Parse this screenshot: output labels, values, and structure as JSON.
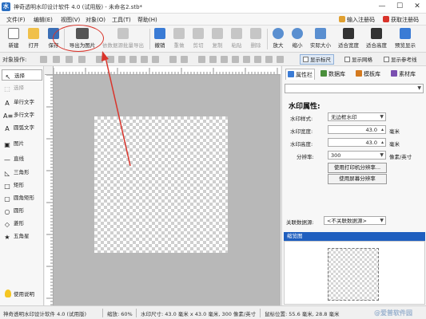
{
  "titlebar": {
    "title": "神奇透明水印设计软件 4.0 (试用版) - 未命名2.stb*",
    "app_icon_letter": "水",
    "min_glyph": "—",
    "max_glyph": "☐",
    "close_glyph": "✕"
  },
  "menubar": {
    "items": [
      "文件(F)",
      "编辑(E)",
      "视图(V)",
      "对象(O)",
      "工具(T)",
      "帮助(H)"
    ],
    "register_label": "输入注册码",
    "get_code_label": "获取注册码"
  },
  "toolbar": {
    "buttons": [
      {
        "label": "新建",
        "enabled": true
      },
      {
        "label": "打开",
        "enabled": true
      },
      {
        "label": "保存",
        "enabled": true
      },
      {
        "label": "导出为图片",
        "enabled": true
      },
      {
        "label": "依数据源批量导出",
        "enabled": false
      },
      {
        "label": "撤销",
        "enabled": true
      },
      {
        "label": "重做",
        "enabled": false
      },
      {
        "label": "剪切",
        "enabled": false
      },
      {
        "label": "复制",
        "enabled": false
      },
      {
        "label": "粘贴",
        "enabled": false
      },
      {
        "label": "删除",
        "enabled": false
      },
      {
        "label": "放大",
        "enabled": true
      },
      {
        "label": "缩小",
        "enabled": true
      },
      {
        "label": "实际大小",
        "enabled": true
      },
      {
        "label": "适合宽度",
        "enabled": true
      },
      {
        "label": "适合高度",
        "enabled": true
      },
      {
        "label": "预览显示",
        "enabled": true
      }
    ]
  },
  "objbar": {
    "label": "对象操作:",
    "toggles": [
      {
        "label": "显示标尺",
        "active": true
      },
      {
        "label": "显示网格",
        "active": false
      },
      {
        "label": "显示参考线",
        "active": false
      }
    ]
  },
  "tools": [
    {
      "label": "选择",
      "glyph": "↖",
      "selected": true,
      "muted": false
    },
    {
      "label": "选择",
      "glyph": "⬚",
      "selected": false,
      "muted": true
    },
    {
      "label": "单行文字",
      "glyph": "A",
      "selected": false,
      "muted": false
    },
    {
      "label": "多行文字",
      "glyph": "A≡",
      "selected": false,
      "muted": false
    },
    {
      "label": "圆弧文字",
      "glyph": "A",
      "selected": false,
      "muted": false
    },
    {
      "label": "图片",
      "glyph": "▣",
      "selected": false,
      "muted": false
    },
    {
      "label": "直线",
      "glyph": "—",
      "selected": false,
      "muted": false
    },
    {
      "label": "三角形",
      "glyph": "◺",
      "selected": false,
      "muted": false
    },
    {
      "label": "矩形",
      "glyph": "□",
      "selected": false,
      "muted": false
    },
    {
      "label": "圆角矩形",
      "glyph": "▢",
      "selected": false,
      "muted": false
    },
    {
      "label": "圆形",
      "glyph": "○",
      "selected": false,
      "muted": false
    },
    {
      "label": "菱形",
      "glyph": "◇",
      "selected": false,
      "muted": false
    },
    {
      "label": "五角星",
      "glyph": "★",
      "selected": false,
      "muted": false
    }
  ],
  "help_label": "使用说明",
  "right_panel": {
    "tabs": [
      {
        "label": "属性栏",
        "active": true,
        "color": "#3a7bd5"
      },
      {
        "label": "数据库",
        "active": false,
        "color": "#4a8f3c"
      },
      {
        "label": "模板库",
        "active": false,
        "color": "#d47a1f"
      },
      {
        "label": "素材库",
        "active": false,
        "color": "#7a4fb0"
      }
    ],
    "top_select_value": "",
    "section_title": "水印属性:",
    "style_label": "水印样式:",
    "style_value": "无边框水印",
    "width_label": "水印宽度:",
    "width_value": "43.0",
    "width_unit": "毫米",
    "height_label": "水印高度:",
    "height_value": "43.0",
    "height_unit": "毫米",
    "resolution_label": "分辨率:",
    "resolution_value": "300",
    "resolution_unit": "像素/英寸",
    "printer_button": "使用打印机分辨率...",
    "screen_button": "使用屏幕分辨率",
    "datasource_label": "关联数据源:",
    "datasource_value": "<不关联数据源>",
    "thumb_header": "缩览图"
  },
  "status": {
    "app": "神奇透明水印设计软件 4.0 (试用版)",
    "zoom": "缩放: 60%",
    "size": "水印尺寸: 43.0 毫米 x 43.0 毫米, 300 像素/英寸",
    "coords": "鼠标位置: 55.6 毫米, 28.8 毫米"
  },
  "watermark_text": "@爱普软件园",
  "colors": {
    "annotation": "#d9342b",
    "thumb_header": "#1f5fbf",
    "brand_icon": "#2b6fc2"
  }
}
